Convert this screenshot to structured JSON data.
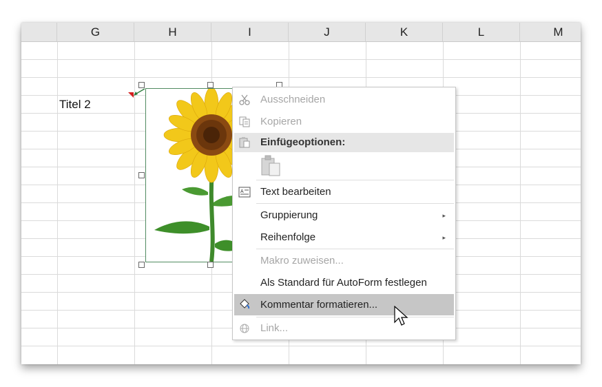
{
  "sheet": {
    "columns": [
      "G",
      "H",
      "I",
      "J",
      "K",
      "L",
      "M"
    ],
    "cell_text": "Titel 2"
  },
  "context_menu": {
    "items": [
      {
        "label": "Ausschneiden",
        "disabled": true,
        "icon": "scissors-icon"
      },
      {
        "label": "Kopieren",
        "disabled": true,
        "icon": "copy-icon"
      },
      {
        "label": "Einfügeoptionen:",
        "header": true,
        "icon": "clipboard-icon"
      },
      {
        "label": "Text bearbeiten",
        "icon": "text-edit-icon"
      },
      {
        "label": "Gruppierung",
        "submenu": true
      },
      {
        "label": "Reihenfolge",
        "submenu": true
      },
      {
        "label": "Makro zuweisen...",
        "disabled": true
      },
      {
        "label": "Als Standard für AutoForm festlegen"
      },
      {
        "label": "Kommentar formatieren...",
        "hover": true,
        "icon": "format-paint-icon"
      },
      {
        "label": "Link...",
        "disabled": true,
        "icon": "link-icon"
      }
    ],
    "submenu_arrow": "▸"
  }
}
